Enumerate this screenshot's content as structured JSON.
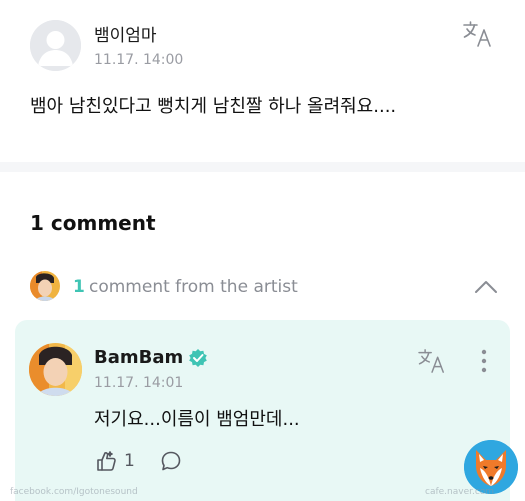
{
  "post": {
    "author": "뱀이엄마",
    "time": "11.17. 14:00",
    "body": "뱀아 남친있다고 뻥치게 남친짤 하나 올려줘요...."
  },
  "comments": {
    "count_label": "1 comment"
  },
  "artist_section": {
    "count": "1",
    "label": "comment from the artist"
  },
  "artist_comment": {
    "author": "BamBam",
    "time": "11.17. 14:01",
    "body": "저기요...이름이 뱀엄만데...",
    "like_count": "1"
  },
  "watermarks": {
    "left": "facebook.com/Igotonesound",
    "right": "cafe.naver.com"
  },
  "icons": {
    "translate": "translate-icon",
    "chevron": "chevron-up-icon",
    "more": "more-vertical-icon",
    "like": "like-icon",
    "reply": "reply-bubble-icon",
    "verified": "verified-badge-icon"
  },
  "colors": {
    "accent": "#3fc4b4",
    "artist_card_bg": "#e8f8f5",
    "verified": "#3fc4b4"
  }
}
